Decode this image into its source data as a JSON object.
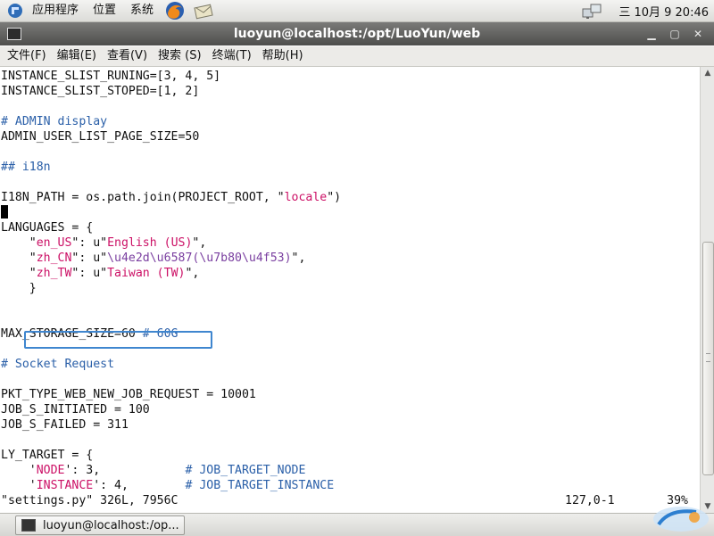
{
  "top_panel": {
    "menus": [
      "应用程序",
      "位置",
      "系统"
    ],
    "clock": "三 10月  9 20:46"
  },
  "window": {
    "title": "luoyun@localhost:/opt/LuoYun/web"
  },
  "menubar": {
    "items": [
      "文件(F)",
      "编辑(E)",
      "查看(V)",
      "搜索 (S)",
      "终端(T)",
      "帮助(H)"
    ]
  },
  "terminal": {
    "line1": "INSTANCE_SLIST_RUNING=[3, 4, 5]",
    "line2": "INSTANCE_SLIST_STOPED=[1, 2]",
    "line4": "# ADMIN display",
    "line5": "ADMIN_USER_LIST_PAGE_SIZE=50",
    "line7": "## i18n",
    "line9_a": "I18N_PATH = os.path.join(PROJECT_ROOT, \"",
    "line9_str": "locale",
    "line9_b": "\")",
    "line11": "LANGUAGES = {",
    "line12_a": "    \"",
    "line12_key": "en_US",
    "line12_b": "\": u\"",
    "line12_val": "English (US)",
    "line12_c": "\",",
    "line13_a": "    \"",
    "line13_key": "zh_CN",
    "line13_b": "\": u\"",
    "line13_val": "\\u4e2d\\u6587(\\u7b80\\u4f53)",
    "line13_c": "\",",
    "line14_a": "    \"",
    "line14_key": "zh_TW",
    "line14_b": "\": u\"",
    "line14_val": "Taiwan (TW)",
    "line14_c": "\",",
    "line15": "    }",
    "line18_a": "MAX_STORAGE_SIZE=60 ",
    "line18_comment": "# 60G",
    "line20": "# Socket Request",
    "line22": "PKT_TYPE_WEB_NEW_JOB_REQUEST = 10001",
    "line23": "JOB_S_INITIATED = 100",
    "line24": "JOB_S_FAILED = 311",
    "line26": "LY_TARGET = {",
    "line27_a": "    '",
    "line27_key": "NODE",
    "line27_b": "': 3,            ",
    "line27_comment": "# JOB_TARGET_NODE",
    "line28_a": "    '",
    "line28_key": "INSTANCE",
    "line28_b": "': 4,        ",
    "line28_comment": "# JOB_TARGET_INSTANCE",
    "status_file": "\"settings.py\" 326L, 7956C",
    "status_pos": "127,0-1",
    "status_pct": "39%"
  },
  "taskbar": {
    "task_label": "luoyun@localhost:/op..."
  },
  "colors": {
    "keyword": "#cc1166",
    "comment": "#2a5fa8",
    "unicode": "#7a3fa0",
    "highlight": "#3f86cf"
  }
}
